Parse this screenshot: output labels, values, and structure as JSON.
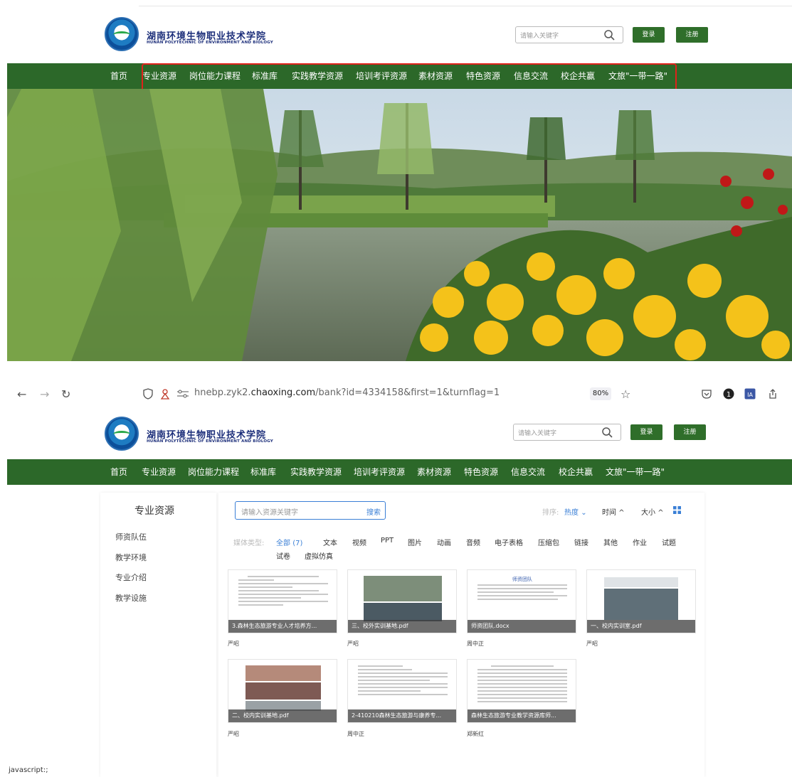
{
  "site": {
    "name_cn": "湖南环境生物职业技术学院",
    "name_en": "HUNAN POLYTECHNIC OF ENVIRONMENT AND BIOLOGY",
    "search_placeholder": "请输入关键字",
    "login": "登录",
    "register": "注册",
    "nav": [
      "首页",
      "专业资源",
      "岗位能力课程",
      "标准库",
      "实践教学资源",
      "培训考评资源",
      "素材资源",
      "特色资源",
      "信息交流",
      "校企共赢",
      "文旅\"一带一路\""
    ],
    "nav_color": "#2c6829",
    "highlight_color": "#e0221b"
  },
  "browser": {
    "url_prefix": "hnebp.zyk2.",
    "url_domain": "chaoxing.com",
    "url_path": "/bank?id=4334158&first=1&turnflag=1",
    "zoom": "80%"
  },
  "resources": {
    "sidebar_title": "专业资源",
    "sidebar_items": [
      "师资队伍",
      "教学环境",
      "专业介绍",
      "教学设施"
    ],
    "search_placeholder": "请输入资源关键字",
    "search_button": "搜索",
    "sort_label": "排序:",
    "sort_hot": "热度",
    "sort_time": "时间",
    "sort_size": "大小",
    "media_label": "媒体类型:",
    "media_all": "全部",
    "media_all_count": "(7)",
    "media_types": [
      "文本",
      "视频",
      "PPT",
      "图片",
      "动画",
      "音频",
      "电子表格",
      "压缩包",
      "链接",
      "其他",
      "作业",
      "试题"
    ],
    "media_types_row2": [
      "试卷",
      "虚拟仿真"
    ],
    "items": [
      {
        "title": "3.森林生态旅游专业人才培养方...",
        "author": "严昭"
      },
      {
        "title": "三、校外实训基地.pdf",
        "author": "严昭"
      },
      {
        "title": "师资团队.docx",
        "author": "周中正"
      },
      {
        "title": "一、校内实训室.pdf",
        "author": "严昭"
      },
      {
        "title": "二、校内实训基地.pdf",
        "author": "严昭"
      },
      {
        "title": "2-410210森林生态旅游与康养专...",
        "author": "周中正"
      },
      {
        "title": "森林生态旅游专业教学资源库师...",
        "author": "郑新红"
      }
    ],
    "thumb_heading_teachers": "师资团队"
  },
  "status_bar": "javascript:;"
}
